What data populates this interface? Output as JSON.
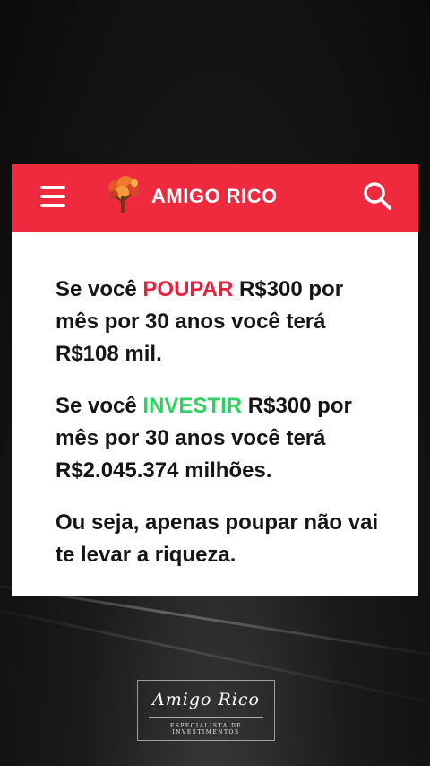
{
  "header": {
    "brand": "AMIGO RICO",
    "menu_icon": "hamburger-menu-icon",
    "logo_icon": "tree-logo-icon",
    "search_icon": "search-icon",
    "color": "#ef2a3f"
  },
  "content": {
    "p1": {
      "prefix": "Se você ",
      "highlight": "POUPAR",
      "suffix": " R$300 por mês por 30 anos você terá R$108 mil."
    },
    "p2": {
      "prefix": "Se você ",
      "highlight": "INVESTIR",
      "suffix": " R$300 por mês por 30 anos você terá R$2.045.374 milhões."
    },
    "p3": {
      "text": "Ou seja, apenas poupar não vai te levar a riqueza."
    },
    "colors": {
      "poupar": "#e8203b",
      "investir": "#2fd162",
      "text": "#151515"
    }
  },
  "signature": {
    "name": "Amigo Rico",
    "subtitle": "ESPECIALISTA DE INVESTIMENTOS"
  }
}
